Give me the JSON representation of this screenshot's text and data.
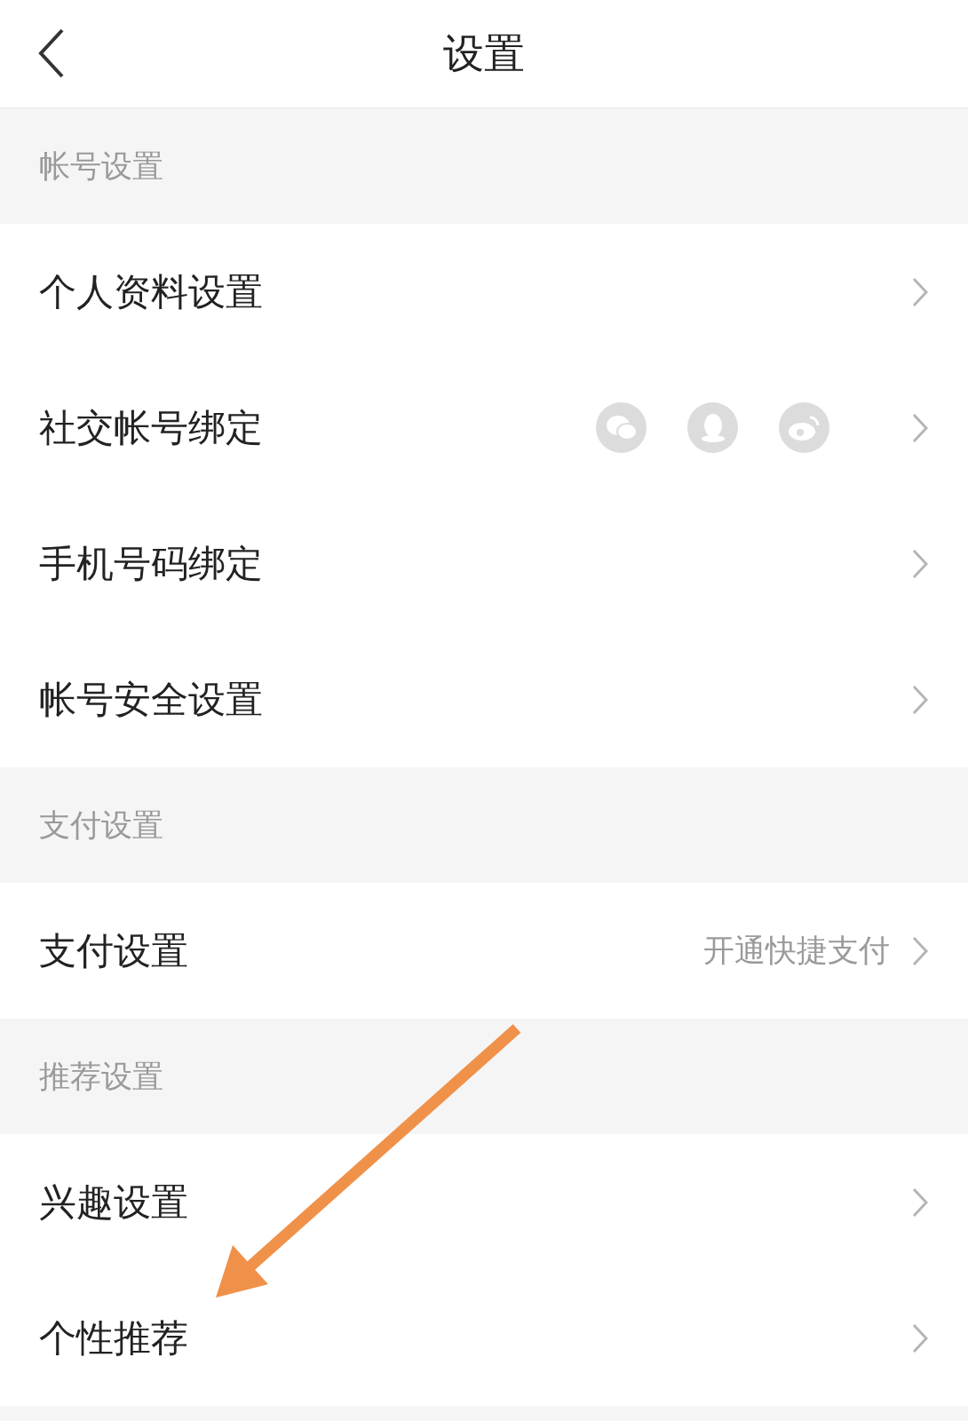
{
  "header": {
    "title": "设置"
  },
  "sections": [
    {
      "title": "帐号设置",
      "items": [
        {
          "label": "个人资料设置",
          "kind": "plain"
        },
        {
          "label": "社交帐号绑定",
          "kind": "social"
        },
        {
          "label": "手机号码绑定",
          "kind": "plain"
        },
        {
          "label": "帐号安全设置",
          "kind": "plain"
        }
      ]
    },
    {
      "title": "支付设置",
      "items": [
        {
          "label": "支付设置",
          "kind": "value",
          "value": "开通快捷支付"
        }
      ]
    },
    {
      "title": "推荐设置",
      "items": [
        {
          "label": "兴趣设置",
          "kind": "plain"
        },
        {
          "label": "个性推荐",
          "kind": "plain"
        }
      ]
    }
  ]
}
